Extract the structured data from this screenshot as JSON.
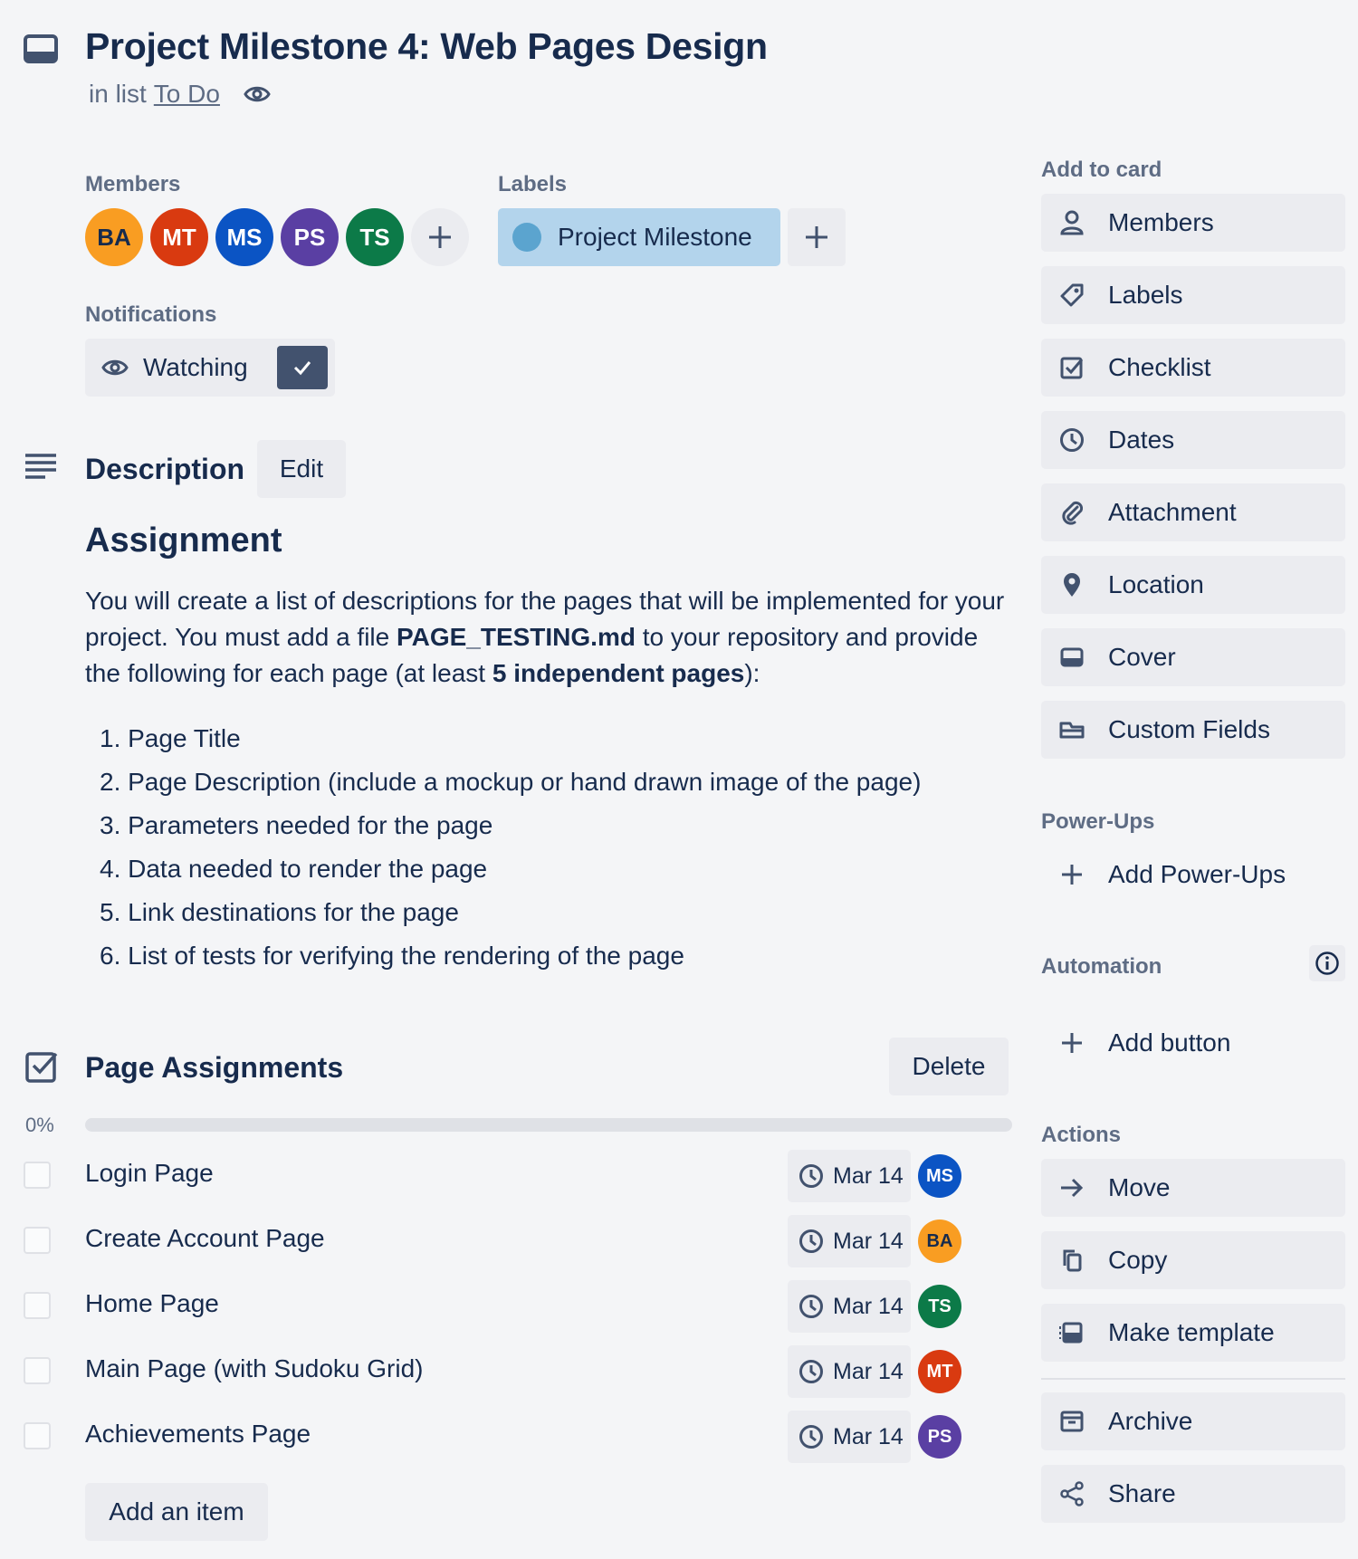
{
  "card": {
    "title": "Project Milestone 4: Web Pages Design",
    "in_list_prefix": "in list",
    "list_name": "To Do"
  },
  "members": {
    "label": "Members",
    "avatars": [
      {
        "initials": "BA",
        "color": "#f99d22"
      },
      {
        "initials": "MT",
        "color": "#d93a10"
      },
      {
        "initials": "MS",
        "color": "#0b54c4"
      },
      {
        "initials": "PS",
        "color": "#5a3fa3"
      },
      {
        "initials": "TS",
        "color": "#0c7a48"
      }
    ]
  },
  "labels": {
    "label": "Labels",
    "items": [
      {
        "name": "Project Milestone",
        "color": "#b3d4ec",
        "dot_color": "#5ba4cf"
      }
    ]
  },
  "notifications": {
    "label": "Notifications",
    "watch_label": "Watching",
    "watching": true
  },
  "description": {
    "title": "Description",
    "edit_label": "Edit",
    "heading": "Assignment",
    "para_1": "You will create a list of descriptions for the pages that will be implemented for your project. You must add a file ",
    "para_bold_1": "PAGE_TESTING.md",
    "para_2": " to your repository and provide the following for each page (at least ",
    "para_bold_2": "5 independent pages",
    "para_3": "):",
    "list": [
      "1. Page Title",
      "2. Page Description (include a mockup or hand drawn image of the page)",
      "3. Parameters needed for the page",
      "4. Data needed to render the page",
      "5. Link destinations for the page",
      "6. List of tests for verifying the rendering of the page"
    ]
  },
  "checklist": {
    "title": "Page Assignments",
    "delete_label": "Delete",
    "progress_text": "0%",
    "progress_value": 0,
    "items": [
      {
        "text": "Login Page",
        "due": "Mar 14",
        "assignee": "MS",
        "assignee_color": "#0b54c4",
        "checked": false
      },
      {
        "text": "Create Account Page",
        "due": "Mar 14",
        "assignee": "BA",
        "assignee_color": "#f99d22",
        "checked": false
      },
      {
        "text": "Home Page",
        "due": "Mar 14",
        "assignee": "TS",
        "assignee_color": "#0c7a48",
        "checked": false
      },
      {
        "text": "Main Page (with Sudoku Grid)",
        "due": "Mar 14",
        "assignee": "MT",
        "assignee_color": "#d93a10",
        "checked": false
      },
      {
        "text": "Achievements Page",
        "due": "Mar 14",
        "assignee": "PS",
        "assignee_color": "#5a3fa3",
        "checked": false
      }
    ],
    "add_item_label": "Add an item"
  },
  "sidebar": {
    "add_to_card_label": "Add to card",
    "add_to_card": [
      {
        "label": "Members",
        "icon": "person-icon"
      },
      {
        "label": "Labels",
        "icon": "tag-icon"
      },
      {
        "label": "Checklist",
        "icon": "checkbox-icon"
      },
      {
        "label": "Dates",
        "icon": "clock-icon"
      },
      {
        "label": "Attachment",
        "icon": "paperclip-icon"
      },
      {
        "label": "Location",
        "icon": "pin-icon"
      },
      {
        "label": "Cover",
        "icon": "cover-icon"
      },
      {
        "label": "Custom Fields",
        "icon": "custom-fields-icon"
      }
    ],
    "powerups_label": "Power-Ups",
    "add_powerups_label": "Add Power-Ups",
    "automation_label": "Automation",
    "add_button_label": "Add button",
    "actions_label": "Actions",
    "actions": [
      {
        "label": "Move",
        "icon": "arrow-right-icon"
      },
      {
        "label": "Copy",
        "icon": "copy-icon"
      },
      {
        "label": "Make template",
        "icon": "template-icon"
      },
      {
        "label": "Archive",
        "icon": "archive-icon"
      },
      {
        "label": "Share",
        "icon": "share-icon"
      }
    ]
  },
  "colors": {
    "text": "#172b4d",
    "muted": "#5e6c84",
    "button_bg": "#ebecf0",
    "page_bg": "#f4f5f7"
  }
}
